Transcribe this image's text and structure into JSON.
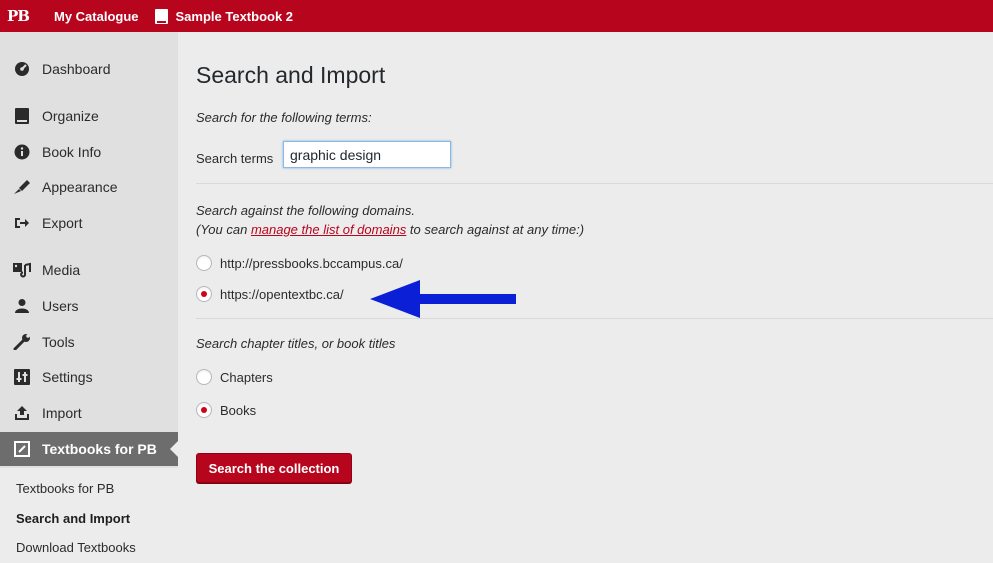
{
  "topbar": {
    "logo": "PB",
    "catalogue_label": "My Catalogue",
    "book_label": "Sample Textbook 2"
  },
  "sidebar": {
    "items": [
      {
        "label": "Dashboard",
        "icon": "dashboard-icon"
      },
      {
        "label": "Organize",
        "icon": "book-icon"
      },
      {
        "label": "Book Info",
        "icon": "info-icon"
      },
      {
        "label": "Appearance",
        "icon": "brush-icon"
      },
      {
        "label": "Export",
        "icon": "export-icon"
      },
      {
        "label": "Media",
        "icon": "media-icon"
      },
      {
        "label": "Users",
        "icon": "user-icon"
      },
      {
        "label": "Tools",
        "icon": "wrench-icon"
      },
      {
        "label": "Settings",
        "icon": "settings-icon"
      },
      {
        "label": "Import",
        "icon": "import-icon"
      },
      {
        "label": "Textbooks for PB",
        "icon": "textbooks-icon",
        "active": true
      }
    ],
    "submenu": [
      {
        "label": "Textbooks for PB"
      },
      {
        "label": "Search and Import",
        "current": true
      },
      {
        "label": "Download Textbooks"
      }
    ]
  },
  "main": {
    "title": "Search and Import",
    "terms_instruction": "Search for the following terms:",
    "search_label": "Search terms",
    "search_value": "graphic design",
    "domains_instruction_1": "Search against the following domains.",
    "domains_instruction_2_pre": "(You can ",
    "domains_instruction_link": "manage the list of domains",
    "domains_instruction_2_post": " to search against at any time:)",
    "domains": [
      {
        "label": "http://pressbooks.bccampus.ca/",
        "checked": false
      },
      {
        "label": "https://opentextbc.ca/",
        "checked": true
      }
    ],
    "scope_instruction": "Search chapter titles, or book titles",
    "scopes": [
      {
        "label": "Chapters",
        "checked": false
      },
      {
        "label": "Books",
        "checked": true
      }
    ],
    "submit_label": "Search the collection"
  },
  "colors": {
    "brand": "#b8051e",
    "arrow": "#0b1fd6",
    "sidebar_active": "#6d6d6d"
  }
}
